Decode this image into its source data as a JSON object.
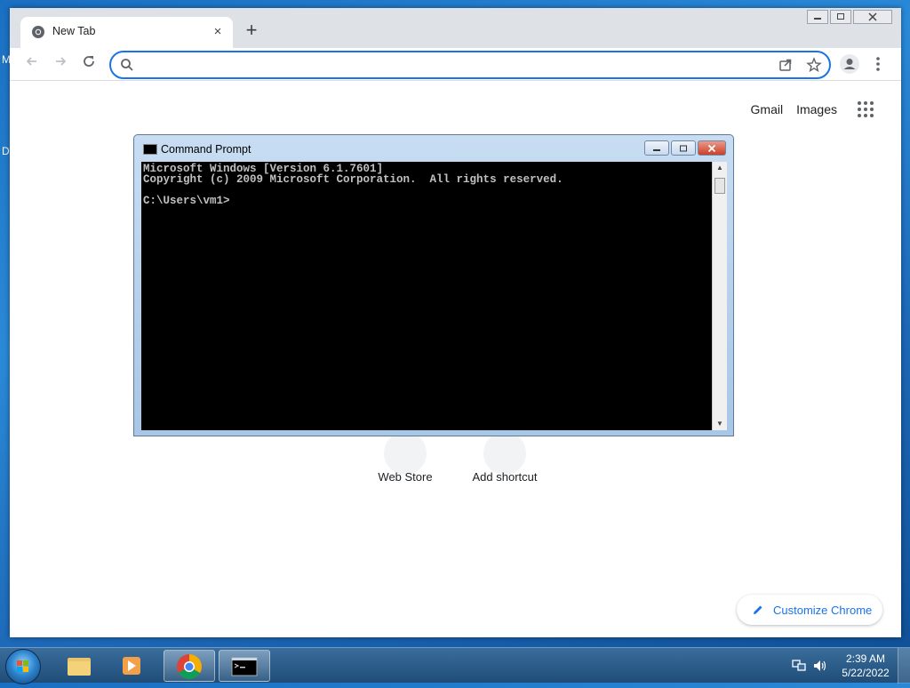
{
  "desktop": {
    "edge_text_1": "M",
    "edge_text_2": "D"
  },
  "chrome": {
    "tab": {
      "title": "New Tab",
      "favicon": "chrome-icon",
      "close": "×"
    },
    "new_tab_symbol": "+",
    "omnibox": {
      "value": "",
      "placeholder": ""
    },
    "ntp": {
      "top_links": [
        "Gmail",
        "Images"
      ],
      "shortcuts": [
        {
          "label": "Web Store",
          "icon": "web-store-icon"
        },
        {
          "label": "Add shortcut",
          "icon": "plus-icon"
        }
      ],
      "customize_label": "Customize Chrome"
    }
  },
  "cmd": {
    "title": "Command Prompt",
    "lines": [
      "Microsoft Windows [Version 6.1.7601]",
      "Copyright (c) 2009 Microsoft Corporation.  All rights reserved.",
      "",
      "C:\\Users\\vm1>"
    ],
    "text": "Microsoft Windows [Version 6.1.7601]\nCopyright (c) 2009 Microsoft Corporation.  All rights reserved.\n\nC:\\Users\\vm1>"
  },
  "taskbar": {
    "items": [
      {
        "name": "explorer",
        "icon": "folder-icon"
      },
      {
        "name": "media-player",
        "icon": "media-player-icon"
      },
      {
        "name": "chrome",
        "icon": "chrome-icon",
        "active": true
      },
      {
        "name": "command-prompt",
        "icon": "cmd-icon",
        "active": true
      }
    ],
    "clock": {
      "time": "2:39 AM",
      "date": "5/22/2022"
    }
  },
  "colors": {
    "accent": "#1a73e8",
    "cmd_bg": "#000000",
    "cmd_text": "#c0c0c0"
  }
}
